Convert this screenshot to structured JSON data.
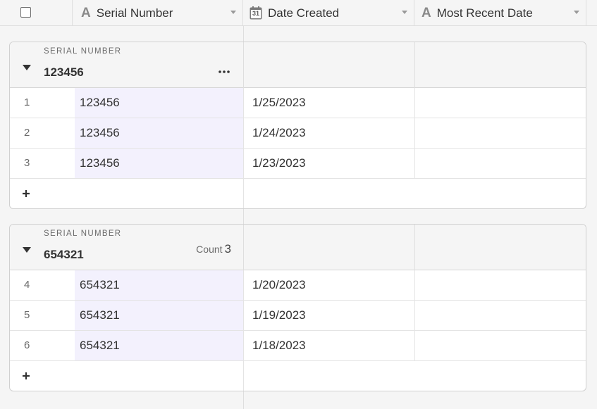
{
  "header": {
    "columns": [
      {
        "label": "Serial Number",
        "icon": "text-field-icon"
      },
      {
        "label": "Date Created",
        "icon": "calendar-field-icon",
        "icon_text": "31"
      },
      {
        "label": "Most Recent Date",
        "icon": "text-field-icon"
      }
    ],
    "text_icon_glyph": "A"
  },
  "groups": [
    {
      "label": "SERIAL NUMBER",
      "value": "123456",
      "rows": [
        {
          "num": "1",
          "serial": "123456",
          "date": "1/25/2023",
          "recent": ""
        },
        {
          "num": "2",
          "serial": "123456",
          "date": "1/24/2023",
          "recent": ""
        },
        {
          "num": "3",
          "serial": "123456",
          "date": "1/23/2023",
          "recent": ""
        }
      ]
    },
    {
      "label": "SERIAL NUMBER",
      "value": "654321",
      "count_label": "Count",
      "count_value": "3",
      "rows": [
        {
          "num": "4",
          "serial": "654321",
          "date": "1/20/2023",
          "recent": ""
        },
        {
          "num": "5",
          "serial": "654321",
          "date": "1/19/2023",
          "recent": ""
        },
        {
          "num": "6",
          "serial": "654321",
          "date": "1/18/2023",
          "recent": ""
        }
      ]
    }
  ],
  "colors": {
    "background": "#f5f5f5",
    "primary_column_fill": "#f3f1fd",
    "border": "#dedede",
    "text": "#333333",
    "muted_text": "#6b6b6b"
  }
}
